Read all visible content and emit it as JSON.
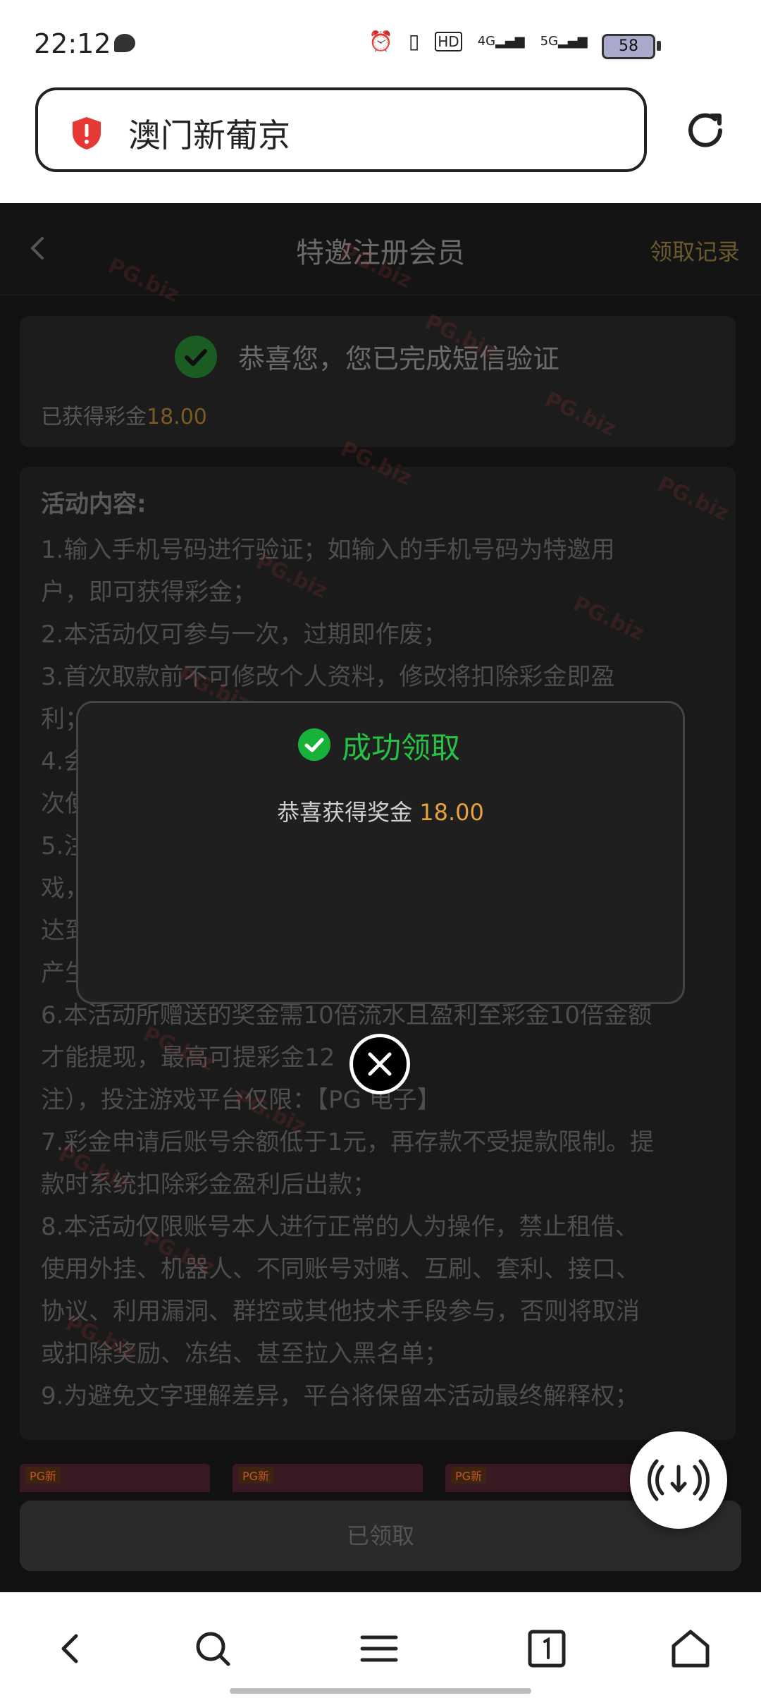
{
  "status_bar": {
    "time": "22:12",
    "icons": [
      "message-icon",
      "alarm-icon",
      "vibrate-icon",
      "hd-icon",
      "signal-4g-icon",
      "signal-5g-icon",
      "wifi-icon"
    ],
    "network_4g": "4G",
    "network_5g": "5G",
    "hd": "HD",
    "battery": "58"
  },
  "browser": {
    "url_text": "澳门新葡京"
  },
  "header": {
    "title": "特邀注册会员",
    "right_link": "领取记录"
  },
  "verify_card": {
    "message": "恭喜您，您已完成短信验证",
    "bonus_label": "已获得彩金",
    "bonus_amount": "18.00"
  },
  "activity": {
    "title": "活动内容:",
    "lines": [
      "1.输入手机号码进行验证；如输入的手机号码为特邀用",
      "户，即可获得彩金；",
      "2.本活动仅可参与一次，过期即作废；",
      "3.首次取款前不可修改个人资料，修改将扣除彩金即盈",
      "利；",
      "4.会",
      "次使",
      "5.注",
      "戏，",
      "达到",
      "产生",
      "6.本活动所赠送的奖金需10倍流水且盈利至彩金10倍金额",
      "才能提现，最高可提彩金12",
      "注），投注游戏平台仅限：【PG 电子】",
      "7.彩金申请后账号余额低于1元，再存款不受提款限制。提",
      "款时系统扣除彩金盈利后出款；",
      "8.本活动仅限账号本人进行正常的人为操作，禁止租借、",
      "使用外挂、机器人、不同账号对赌、互刷、套利、接口、",
      "协议、利用漏洞、群控或其他技术手段参与，否则将取消",
      "或扣除奖励、冻结、甚至拉入黑名单；",
      "9.为避免文字理解差异，平台将保留本活动最终解释权；"
    ]
  },
  "games": {
    "tag": "PG新"
  },
  "claimed_button": "已领取",
  "modal": {
    "title": "成功领取",
    "message": "恭喜获得奖金",
    "amount": "18.00"
  },
  "watermark": "PG.biz",
  "colors": {
    "success_green": "#27c245",
    "amount_orange": "#e8a33a",
    "danger_red": "#e53935"
  }
}
